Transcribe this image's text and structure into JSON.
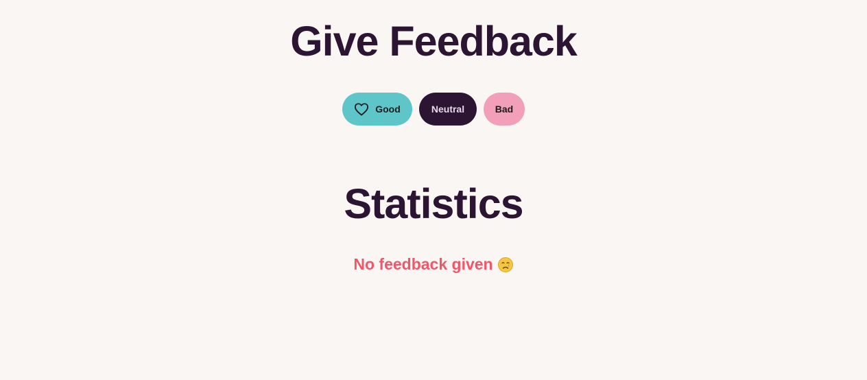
{
  "feedback": {
    "title": "Give Feedback",
    "buttons": {
      "good_label": "Good",
      "good_icon": "heart-outline-icon",
      "neutral_label": "Neutral",
      "bad_label": "Bad"
    }
  },
  "statistics": {
    "title": "Statistics",
    "empty_message": "No feedback given",
    "empty_icon": "crying-face-icon"
  },
  "colors": {
    "background": "#faf6f3",
    "heading": "#2b1533",
    "good_button": "#5ec5c9",
    "neutral_button": "#2b1533",
    "bad_button": "#f2a0b9",
    "empty_message": "#f0586a"
  }
}
